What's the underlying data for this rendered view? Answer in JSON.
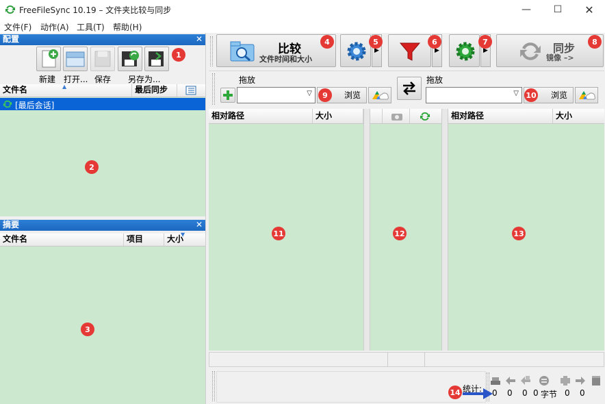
{
  "window": {
    "title": "FreeFileSync 10.19 – 文件夹比较与同步"
  },
  "menu": [
    {
      "label": "文件(F)"
    },
    {
      "label": "动作(A)"
    },
    {
      "label": "工具(T)"
    },
    {
      "label": "帮助(H)"
    }
  ],
  "config_panel": {
    "title": "配置",
    "buttons": {
      "new": "新建",
      "open": "打开...",
      "save": "保存",
      "save_as": "另存为..."
    },
    "columns": {
      "filename": "文件名",
      "last_sync": "最后同步"
    },
    "sessions": [
      {
        "label": "[最后会话]"
      }
    ]
  },
  "summary_panel": {
    "title": "摘要",
    "columns": {
      "filename": "文件名",
      "items": "项目",
      "size": "大小"
    }
  },
  "toolbar": {
    "compare": {
      "label": "比较",
      "sublabel": "文件时间和大小"
    },
    "sync": {
      "label": "同步",
      "sublabel": "镜像 –>"
    }
  },
  "folders": {
    "left": {
      "drag_label": "拖放",
      "browse": "浏览",
      "value": ""
    },
    "right": {
      "drag_label": "拖放",
      "browse": "浏览",
      "value": ""
    }
  },
  "grid": {
    "left": {
      "col_path": "相对路径",
      "col_size": "大小"
    },
    "right": {
      "col_path": "相对路径",
      "col_size": "大小"
    }
  },
  "stats": {
    "label": "统计:",
    "values": [
      "0",
      "0",
      "0",
      "0",
      "0",
      "0"
    ],
    "bytes_unit": "字节"
  },
  "badges": [
    "1",
    "2",
    "3",
    "4",
    "5",
    "6",
    "7",
    "8",
    "9",
    "10",
    "11",
    "12",
    "13",
    "14"
  ],
  "colors": {
    "panel_green": "#cce8cf",
    "header_blue": "#1b68c0",
    "badge_red": "#e53935",
    "selection_blue": "#0a64d6"
  }
}
